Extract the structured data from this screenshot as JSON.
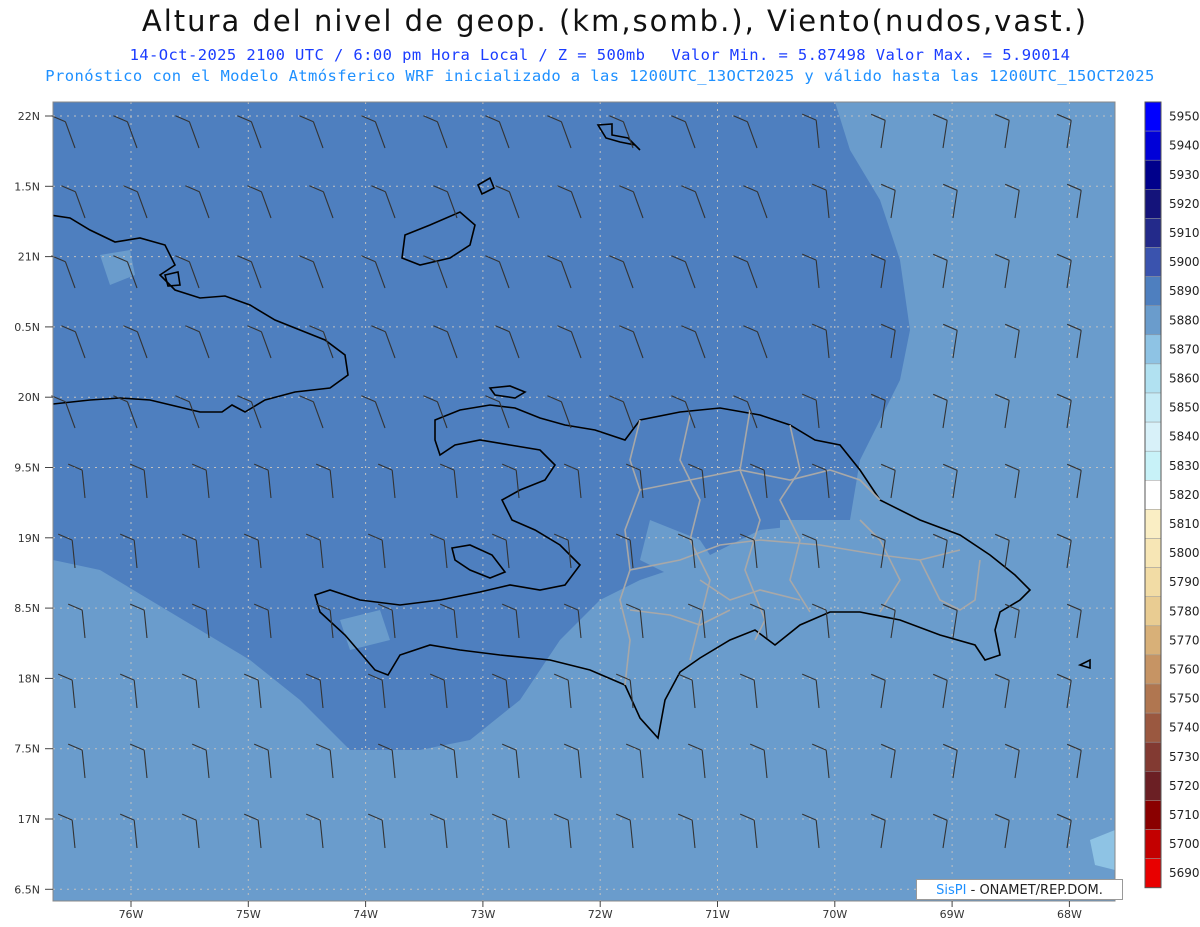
{
  "title": "Altura del nivel de geop. (km,somb.), Viento(nudos,vast.)",
  "subtitle": {
    "datetime": "14-Oct-2025  2100 UTC / 6:00 pm Hora Local / Z = 500mb",
    "values": "Valor Min. = 5.87498  Valor Max. = 5.90014",
    "model": "Pronóstico con el Modelo Atmósferico WRF inicializado a las 1200UTC_13OCT2025 y válido hasta las  1200UTC_15OCT2025"
  },
  "axes": {
    "lat_labels": [
      "22N",
      "1.5N",
      "21N",
      "0.5N",
      "20N",
      "9.5N",
      "19N",
      "8.5N",
      "18N",
      "7.5N",
      "17N",
      "6.5N"
    ],
    "lon_labels": [
      "76W",
      "75W",
      "74W",
      "73W",
      "72W",
      "71W",
      "70W",
      "69W",
      "68W"
    ]
  },
  "colorbar": {
    "levels": [
      {
        "label": "5950",
        "color": "#0000ff"
      },
      {
        "label": "5940",
        "color": "#0000d8"
      },
      {
        "label": "5930",
        "color": "#00008b"
      },
      {
        "label": "5920",
        "color": "#14137a"
      },
      {
        "label": "5910",
        "color": "#232a8a"
      },
      {
        "label": "5900",
        "color": "#3a53ae"
      },
      {
        "label": "5890",
        "color": "#4e7fbf"
      },
      {
        "label": "5880",
        "color": "#6a9ccc"
      },
      {
        "label": "5870",
        "color": "#8ec3e4"
      },
      {
        "label": "5860",
        "color": "#b1e1f1"
      },
      {
        "label": "5850",
        "color": "#c6ebf6"
      },
      {
        "label": "5840",
        "color": "#d8f1f9"
      },
      {
        "label": "5830",
        "color": "#c8f2f8"
      },
      {
        "label": "5820",
        "color": "#ffffff"
      },
      {
        "label": "5810",
        "color": "#faeec4"
      },
      {
        "label": "5800",
        "color": "#f7e6b5"
      },
      {
        "label": "5790",
        "color": "#f2dca5"
      },
      {
        "label": "5780",
        "color": "#e9cc92"
      },
      {
        "label": "5770",
        "color": "#d8b078"
      },
      {
        "label": "5760",
        "color": "#c69464"
      },
      {
        "label": "5750",
        "color": "#b07650"
      },
      {
        "label": "5740",
        "color": "#9a5840"
      },
      {
        "label": "5730",
        "color": "#823a32"
      },
      {
        "label": "5720",
        "color": "#6b1f24"
      },
      {
        "label": "5710",
        "color": "#8a0000"
      },
      {
        "label": "5700",
        "color": "#c30000"
      },
      {
        "label": "5690",
        "color": "#e80000"
      }
    ]
  },
  "credit": {
    "brand": "SisPI",
    "rest": " - ONAMET/REP.DOM."
  },
  "colors": {
    "field_dark": "#4e7fbf",
    "field_light": "#6a9ccc",
    "coast": "#000000",
    "province": "#a8a8a8"
  }
}
